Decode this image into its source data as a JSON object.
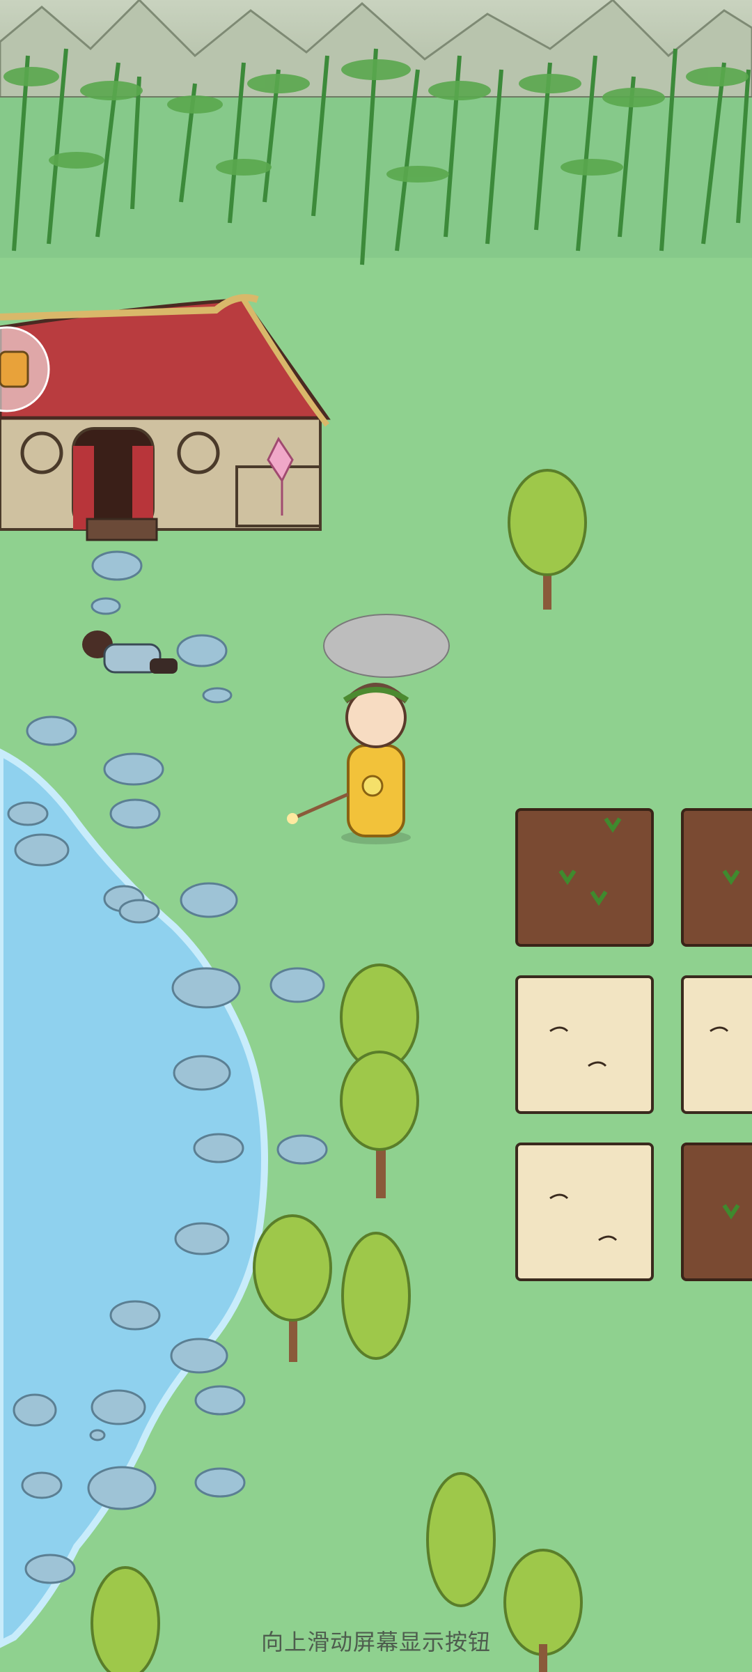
{
  "footer": {
    "hint": "向上滑动屏幕显示按钮"
  },
  "colors": {
    "grass": "#8fd18f",
    "water": "#8fd1ee",
    "soil": "#7a4a32",
    "sand": "#f2e4c2",
    "roof": "#b93c3f",
    "tree_leaf": "#9ec84a",
    "outfit": "#f2c23a"
  },
  "icons": {
    "side_button": "menu-bubble-icon"
  }
}
